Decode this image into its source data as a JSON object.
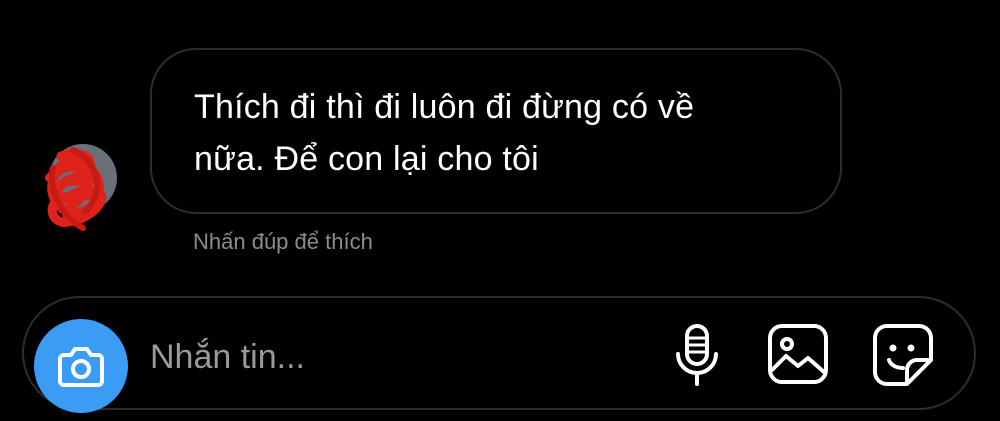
{
  "message": {
    "text": "Thích đi thì đi luôn đi đừng có về\nnữa. Để con lại cho tôi",
    "hint": "Nhấn đúp để thích"
  },
  "composer": {
    "placeholder": "Nhắn tin..."
  },
  "colors": {
    "background": "#000000",
    "bubble_border": "#2d2d2d",
    "camera_button": "#3b9cf6",
    "hint_text": "#8c8c8c",
    "scribble": "#e0221c"
  },
  "icons": {
    "camera": "camera-icon",
    "mic": "mic-icon",
    "image": "image-icon",
    "sticker": "sticker-icon"
  }
}
